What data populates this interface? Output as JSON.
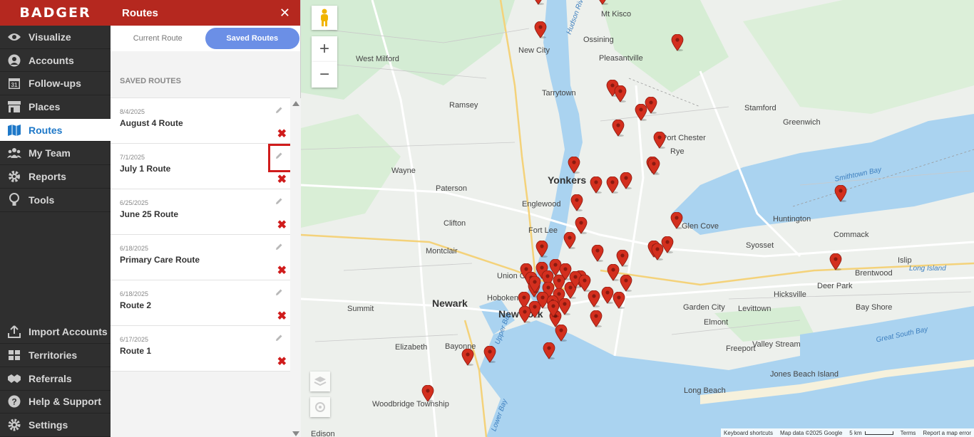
{
  "brand": {
    "logo_text": "BADGER",
    "accent": "#b5281f"
  },
  "nav": {
    "top_items": [
      {
        "label": "Visualize",
        "icon": "eye-icon"
      },
      {
        "label": "Accounts",
        "icon": "person-icon"
      },
      {
        "label": "Follow-ups",
        "icon": "calendar-icon",
        "icon_text": "31"
      },
      {
        "label": "Places",
        "icon": "storefront-icon"
      },
      {
        "label": "Routes",
        "icon": "map-icon",
        "active": true
      },
      {
        "label": "My Team",
        "icon": "team-icon"
      },
      {
        "label": "Reports",
        "icon": "gear-icon"
      },
      {
        "label": "Tools",
        "icon": "lightbulb-icon"
      }
    ],
    "bottom_items": [
      {
        "label": "Import Accounts",
        "icon": "upload-icon"
      },
      {
        "label": "Territories",
        "icon": "grid-icon"
      },
      {
        "label": "Referrals",
        "icon": "handshake-icon"
      },
      {
        "label": "Help & Support",
        "icon": "help-icon"
      },
      {
        "label": "Settings",
        "icon": "settings-icon"
      }
    ]
  },
  "panel": {
    "title": "Routes",
    "close_glyph": "✕",
    "tabs": [
      {
        "label": "Current Route",
        "active": false
      },
      {
        "label": "Saved Routes",
        "active": true
      }
    ],
    "section_label": "SAVED ROUTES",
    "routes": [
      {
        "date": "8/4/2025",
        "name": "August 4 Route"
      },
      {
        "date": "7/1/2025",
        "name": "July 1 Route",
        "edit_highlighted": true
      },
      {
        "date": "6/25/2025",
        "name": "June 25 Route"
      },
      {
        "date": "6/18/2025",
        "name": "Primary Care Route"
      },
      {
        "date": "6/18/2025",
        "name": "Route 2"
      },
      {
        "date": "6/17/2025",
        "name": "Route 1"
      }
    ],
    "delete_glyph": "✖"
  },
  "map": {
    "labels": [
      {
        "text": "Ossining",
        "cls": ""
      },
      {
        "text": "Mt Kisco",
        "cls": ""
      },
      {
        "text": "New City",
        "cls": ""
      },
      {
        "text": "Pleasantville",
        "cls": ""
      },
      {
        "text": "West Milford",
        "cls": ""
      },
      {
        "text": "Tarrytown",
        "cls": ""
      },
      {
        "text": "Ramsey",
        "cls": ""
      },
      {
        "text": "Stamford",
        "cls": ""
      },
      {
        "text": "Greenwich",
        "cls": ""
      },
      {
        "text": "Port Chester",
        "cls": ""
      },
      {
        "text": "Rye",
        "cls": ""
      },
      {
        "text": "Wayne",
        "cls": ""
      },
      {
        "text": "Yonkers",
        "cls": "big"
      },
      {
        "text": "Paterson",
        "cls": ""
      },
      {
        "text": "Englewood",
        "cls": ""
      },
      {
        "text": "Clifton",
        "cls": ""
      },
      {
        "text": "Fort Lee",
        "cls": ""
      },
      {
        "text": "Glen Cove",
        "cls": ""
      },
      {
        "text": "Huntington",
        "cls": ""
      },
      {
        "text": "Commack",
        "cls": ""
      },
      {
        "text": "Syosset",
        "cls": ""
      },
      {
        "text": "Montclair",
        "cls": ""
      },
      {
        "text": "Union City",
        "cls": ""
      },
      {
        "text": "Hoboken",
        "cls": ""
      },
      {
        "text": "Newark",
        "cls": "big"
      },
      {
        "text": "New York",
        "cls": "big"
      },
      {
        "text": "Summit",
        "cls": ""
      },
      {
        "text": "Elizabeth",
        "cls": ""
      },
      {
        "text": "Bayonne",
        "cls": ""
      },
      {
        "text": "Garden City",
        "cls": ""
      },
      {
        "text": "Levittown",
        "cls": ""
      },
      {
        "text": "Hicksville",
        "cls": ""
      },
      {
        "text": "Deer Park",
        "cls": ""
      },
      {
        "text": "Brentwood",
        "cls": ""
      },
      {
        "text": "Islip",
        "cls": ""
      },
      {
        "text": "Bay Shore",
        "cls": ""
      },
      {
        "text": "Elmont",
        "cls": ""
      },
      {
        "text": "Valley Stream",
        "cls": ""
      },
      {
        "text": "Freeport",
        "cls": ""
      },
      {
        "text": "Long Beach",
        "cls": ""
      },
      {
        "text": "Jones Beach Island",
        "cls": ""
      },
      {
        "text": "Woodbridge Township",
        "cls": ""
      },
      {
        "text": "Edison",
        "cls": ""
      },
      {
        "text": "Smithtown Bay",
        "cls": "water"
      },
      {
        "text": "Great South Bay",
        "cls": "water"
      },
      {
        "text": "Long Island",
        "cls": "water"
      },
      {
        "text": "Upper Bay",
        "cls": "water"
      },
      {
        "text": "Lower Bay",
        "cls": "water"
      },
      {
        "text": "Hudson River",
        "cls": "water"
      }
    ],
    "attribution": [
      "Keyboard shortcuts",
      "Map data ©2025 Google",
      "5 km",
      "Terms",
      "Report a map error"
    ],
    "controls": {
      "zoom_in": "+",
      "zoom_out": "−"
    },
    "pin_color": "#d32f1e",
    "pin_count": 62
  }
}
